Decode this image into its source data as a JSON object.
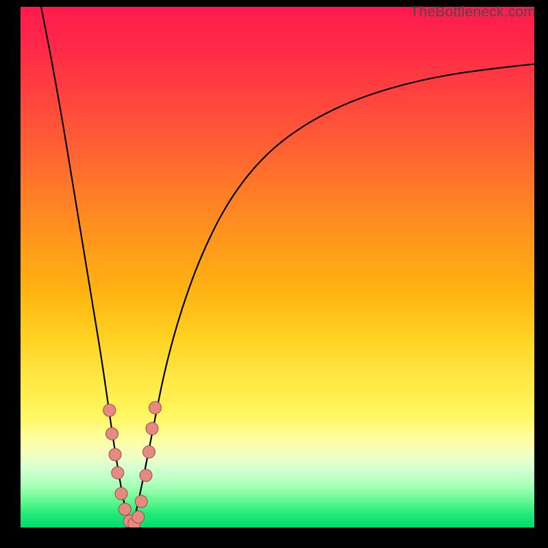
{
  "watermark": "TheBottleneck.com",
  "colors": {
    "marker_fill": "#e58a82",
    "marker_stroke": "#a04a42",
    "curve": "#000000"
  },
  "chart_data": {
    "type": "line",
    "title": "",
    "xlabel": "",
    "ylabel": "",
    "xlim": [
      0,
      100
    ],
    "ylim": [
      0,
      100
    ],
    "grid": false,
    "legend": false,
    "series": [
      {
        "name": "bottleneck-curve",
        "note": "V-shaped curve; x is normalized horizontal position [0..100], y is bottleneck percent [0=green bottom, 100=red top]. Values estimated from pixels.",
        "x": [
          4,
          6,
          8,
          10,
          12,
          14,
          16,
          18,
          19.5,
          20.5,
          21.7,
          22.5,
          24,
          26,
          28,
          31,
          35,
          40,
          46,
          53,
          62,
          72,
          83,
          95,
          100
        ],
        "y": [
          100,
          90,
          79,
          67,
          55,
          43,
          31,
          17,
          8,
          3,
          0,
          3,
          10,
          20,
          30,
          41,
          52,
          62,
          70,
          76,
          81,
          84.5,
          87,
          88.5,
          89
        ]
      }
    ],
    "markers": {
      "note": "salmon scatter dots near the curve minimum; same coordinate convention as series",
      "points": [
        {
          "x": 17.3,
          "y": 22.5
        },
        {
          "x": 17.8,
          "y": 18.0
        },
        {
          "x": 18.4,
          "y": 14.0
        },
        {
          "x": 18.9,
          "y": 10.5
        },
        {
          "x": 19.6,
          "y": 6.5
        },
        {
          "x": 20.3,
          "y": 3.5
        },
        {
          "x": 21.2,
          "y": 1.2
        },
        {
          "x": 22.1,
          "y": 0.7
        },
        {
          "x": 22.9,
          "y": 2.0
        },
        {
          "x": 23.5,
          "y": 5.0
        },
        {
          "x": 24.4,
          "y": 10.0
        },
        {
          "x": 25.0,
          "y": 14.5
        },
        {
          "x": 25.6,
          "y": 19.0
        },
        {
          "x": 26.2,
          "y": 23.0
        }
      ]
    }
  }
}
